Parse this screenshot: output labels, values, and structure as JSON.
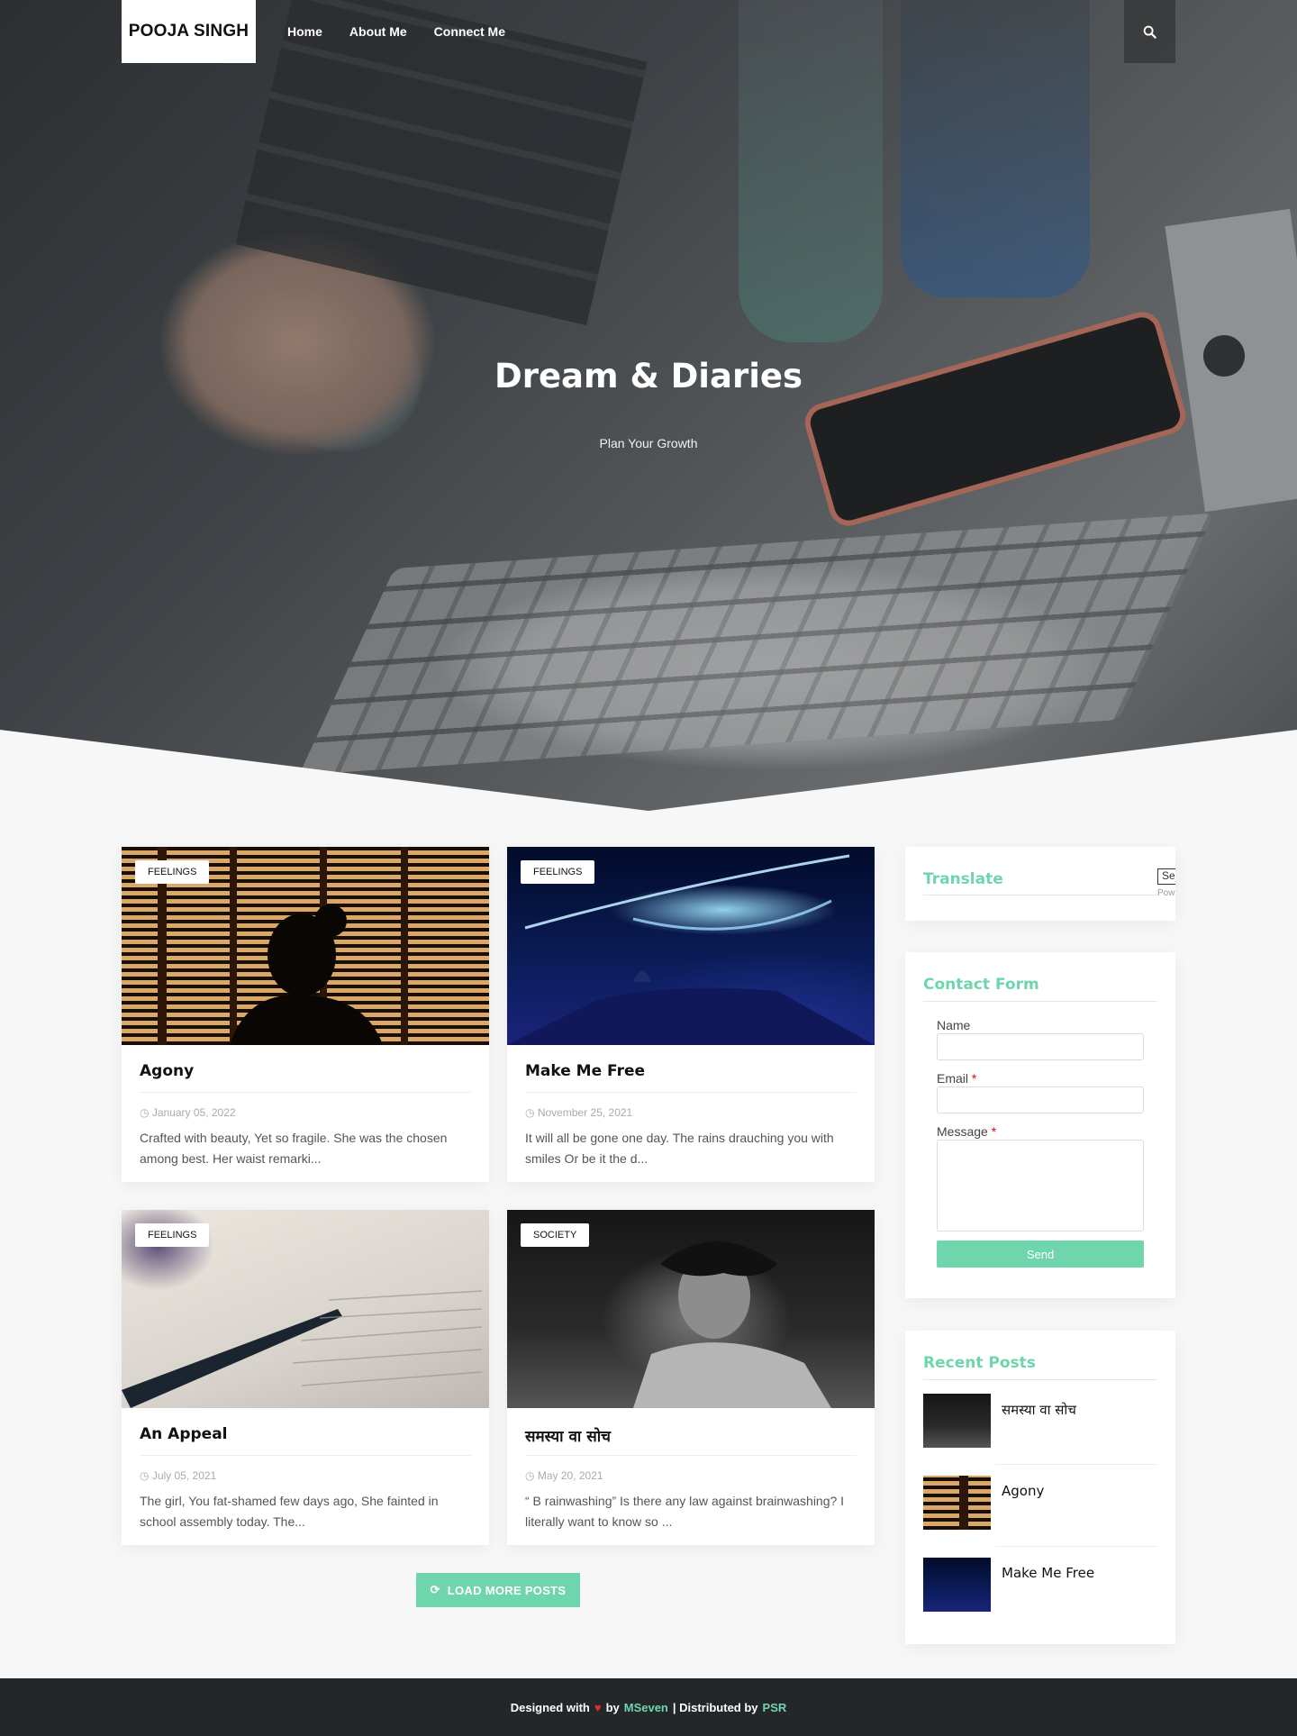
{
  "site": {
    "logo": "POOJA SINGH"
  },
  "nav": {
    "items": [
      "Home",
      "About Me",
      "Connect Me"
    ]
  },
  "hero": {
    "title": "Dream & Diaries",
    "subtitle": "Plan Your Growth"
  },
  "posts": [
    {
      "tag": "FEELINGS",
      "title": "Agony",
      "date": "January 05, 2022",
      "excerpt": "Crafted with beauty, Yet so fragile. She was the chosen among best. Her waist remarki..."
    },
    {
      "tag": "FEELINGS",
      "title": "Make Me Free",
      "date": "November 25, 2021",
      "excerpt": "It will all be gone one day. The rains drauching you with smiles Or be it the d..."
    },
    {
      "tag": "FEELINGS",
      "title": "An Appeal",
      "date": "July 05, 2021",
      "excerpt": "The girl, You fat-shamed few days ago, She fainted in school assembly today. The..."
    },
    {
      "tag": "SOCIETY",
      "title": "समस्या वा सोच",
      "date": "May 20, 2021",
      "excerpt": "“ B rainwashing” Is there any law against brainwashing? I literally want to know so ..."
    }
  ],
  "load_more": "LOAD MORE POSTS",
  "translate_widget": {
    "title": "Translate",
    "select_value": "Se",
    "powered": "Pow"
  },
  "contact_widget": {
    "title": "Contact Form",
    "name_label": "Name",
    "email_label": "Email",
    "message_label": "Message",
    "required_mark": "*",
    "send_label": "Send"
  },
  "recent_widget": {
    "title": "Recent Posts",
    "items": [
      "समस्या वा सोच",
      "Agony",
      "Make Me Free"
    ]
  },
  "footer": {
    "designed_with": "Designed with",
    "by": "by",
    "author": "MSeven",
    "distributed": "| Distributed by",
    "distributor": "PSR"
  },
  "colors": {
    "accent": "#6fd5ad",
    "footer_bg": "#24272a",
    "heart": "#e52d2d"
  },
  "icons": [
    "search-icon",
    "clock-icon",
    "refresh-icon",
    "heart-icon"
  ]
}
